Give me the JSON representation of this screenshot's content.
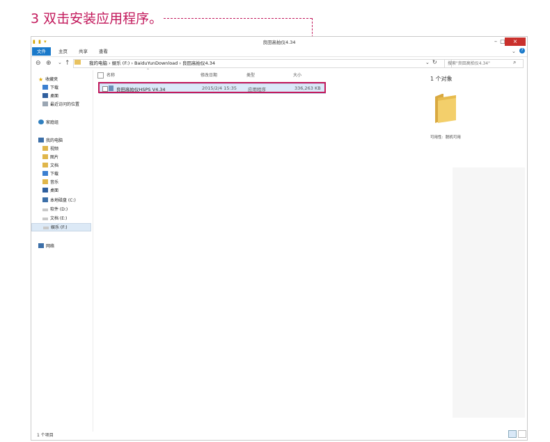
{
  "instruction": "3 双击安装应用程序。",
  "window": {
    "title": "良田高拍仪4.34",
    "controls": {
      "minimize": "–",
      "maximize": "▢",
      "close": "×"
    }
  },
  "ribbon": {
    "tabs": [
      "文件",
      "主页",
      "共享",
      "查看"
    ],
    "help": "?"
  },
  "address": {
    "path": "我的电脑 › 娱乐 (F:) › BaiduYunDownload › 良田高拍仪4.34",
    "search_placeholder": "搜索\"良田高拍仪4.34\""
  },
  "nav": {
    "favorites": [
      "收藏夹",
      "下载",
      "桌面",
      "最近访问的位置"
    ],
    "homegroup": "家庭组",
    "this_pc": "我的电脑",
    "pc_items": [
      "视频",
      "图片",
      "文档",
      "下载",
      "音乐",
      "桌面",
      "本地磁盘 (C:)",
      "软件 (D:)",
      "文档 (E:)",
      "娱乐 (F:)"
    ],
    "network": "网络"
  },
  "columns": {
    "name": "名称",
    "date": "修改日期",
    "type": "类型",
    "size": "大小"
  },
  "file": {
    "name": "良田高拍仪HSPS V4.34",
    "date": "2015/2/4 15:35",
    "type": "应用程序",
    "size": "336,263 KB"
  },
  "details": {
    "count": "1 个对象",
    "availability_label": "可用性:",
    "availability_value": "脱机可用"
  },
  "status": {
    "items": "1 个项目"
  },
  "colors": {
    "accent": "#c2185b",
    "file_tab": "#1979ca",
    "close": "#c9302c"
  }
}
